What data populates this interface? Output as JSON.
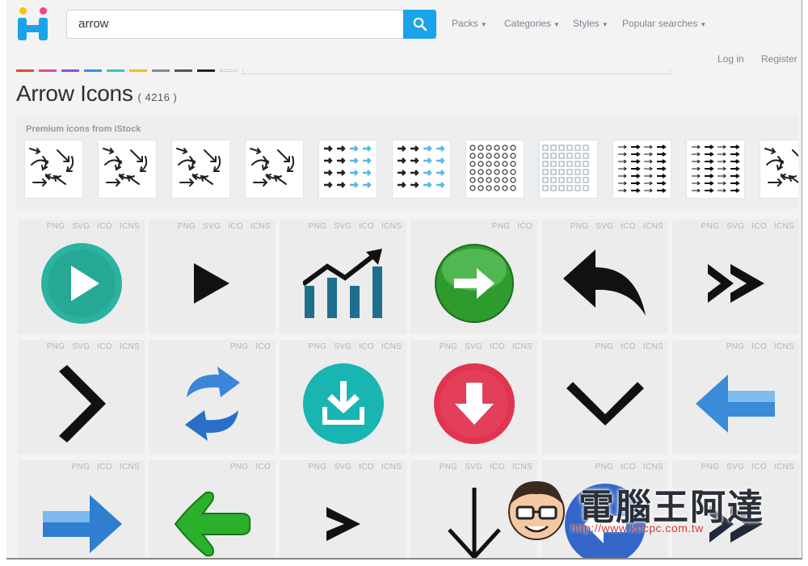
{
  "search": {
    "query": "arrow"
  },
  "nav": {
    "packs": "Packs",
    "categories": "Categories",
    "styles": "Styles",
    "popular": "Popular searches"
  },
  "auth": {
    "login": "Log in",
    "register": "Register"
  },
  "page": {
    "title": "Arrow Icons",
    "count": "( 4216 )"
  },
  "premium": {
    "label": "Premium icons from iStock"
  },
  "icons": [
    {
      "name": "play-circle-teal",
      "formats": [
        "PNG",
        "SVG",
        "ICO",
        "ICNS"
      ]
    },
    {
      "name": "play-triangle-black",
      "formats": [
        "PNG",
        "SVG",
        "ICO",
        "ICNS"
      ]
    },
    {
      "name": "growth-chart-arrow",
      "formats": [
        "PNG",
        "SVG",
        "ICO",
        "ICNS"
      ]
    },
    {
      "name": "green-circle-right-arrow",
      "formats": [
        "PNG",
        "ICO"
      ]
    },
    {
      "name": "reply-arrow-black",
      "formats": [
        "PNG",
        "SVG",
        "ICO",
        "ICNS"
      ]
    },
    {
      "name": "double-chevron-right",
      "formats": [
        "PNG",
        "SVG",
        "ICO",
        "ICNS"
      ]
    },
    {
      "name": "chevron-right-black",
      "formats": [
        "PNG",
        "SVG",
        "ICO",
        "ICNS"
      ]
    },
    {
      "name": "blue-refresh-arrows",
      "formats": [
        "PNG",
        "ICO"
      ]
    },
    {
      "name": "download-circle-teal",
      "formats": [
        "PNG",
        "SVG",
        "ICO",
        "ICNS"
      ]
    },
    {
      "name": "download-circle-red",
      "formats": [
        "PNG",
        "SVG",
        "ICO",
        "ICNS"
      ]
    },
    {
      "name": "chevron-down-black",
      "formats": [
        "PNG",
        "ICO",
        "ICNS"
      ]
    },
    {
      "name": "blue-left-arrow-3d",
      "formats": [
        "PNG",
        "ICO",
        "ICNS"
      ]
    },
    {
      "name": "blue-right-arrow-3d",
      "formats": [
        "PNG",
        "ICO",
        "ICNS"
      ]
    },
    {
      "name": "green-left-arrow-3d",
      "formats": [
        "PNG",
        "ICO"
      ]
    },
    {
      "name": "small-chevron-right",
      "formats": [
        "PNG",
        "SVG",
        "ICO",
        "ICNS"
      ]
    },
    {
      "name": "arrow-down-thin",
      "formats": [
        "PNG",
        "SVG",
        "ICO",
        "ICNS"
      ]
    },
    {
      "name": "blue-circle-left-arrow",
      "formats": [
        "PNG",
        "ICO",
        "ICNS"
      ]
    },
    {
      "name": "double-chevron-right-dark",
      "formats": [
        "PNG",
        "SVG",
        "ICO",
        "ICNS"
      ]
    }
  ],
  "watermark": {
    "text": "電腦王阿達",
    "url": "http://www.kocpc.com.tw"
  },
  "colors": {
    "accent": "#1aa3e8",
    "teal": "#2bb3a0",
    "red": "#e0344f",
    "green": "#2e9b2e",
    "blue": "#2a7fd4"
  }
}
